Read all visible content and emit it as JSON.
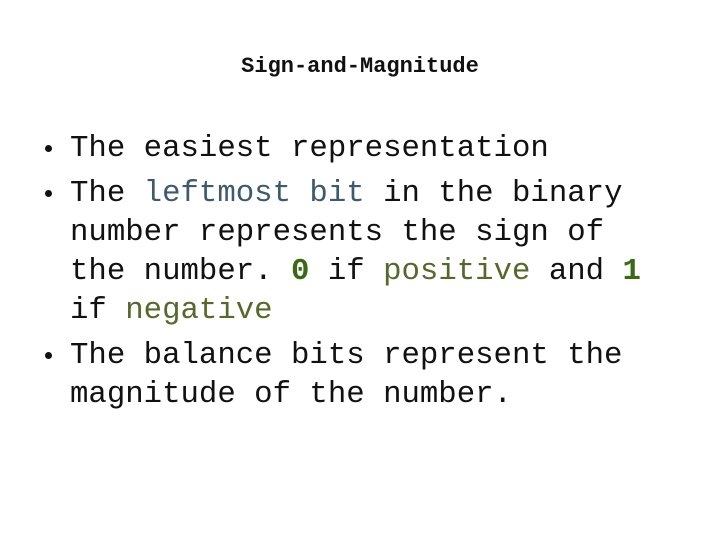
{
  "slide": {
    "title": "Sign-and-Magnitude",
    "colors": {
      "text": "#111111",
      "highlight_blue": "#3e5a6e",
      "highlight_olive": "#56692a",
      "highlight_green_bold": "#3b6a14"
    },
    "bullets": [
      {
        "lines": [
          [
            {
              "text": "The easiest representation",
              "style": "plain"
            }
          ]
        ]
      },
      {
        "lines": [
          [
            {
              "text": "The ",
              "style": "plain"
            },
            {
              "text": "leftmost bit",
              "style": "blue"
            },
            {
              "text": " in the binary",
              "style": "plain"
            }
          ],
          [
            {
              "text": "number represents the sign of",
              "style": "plain"
            }
          ],
          [
            {
              "text": "the number. ",
              "style": "plain"
            },
            {
              "text": "0",
              "style": "bold-green"
            },
            {
              "text": " if ",
              "style": "plain"
            },
            {
              "text": "positive",
              "style": "olive"
            },
            {
              "text": " and ",
              "style": "plain"
            },
            {
              "text": "1",
              "style": "bold-green"
            }
          ],
          [
            {
              "text": "if ",
              "style": "plain"
            },
            {
              "text": "negative",
              "style": "olive"
            }
          ]
        ]
      },
      {
        "lines": [
          [
            {
              "text": "The balance bits represent the",
              "style": "plain"
            }
          ],
          [
            {
              "text": "magnitude of the number.",
              "style": "plain"
            }
          ]
        ]
      }
    ]
  }
}
